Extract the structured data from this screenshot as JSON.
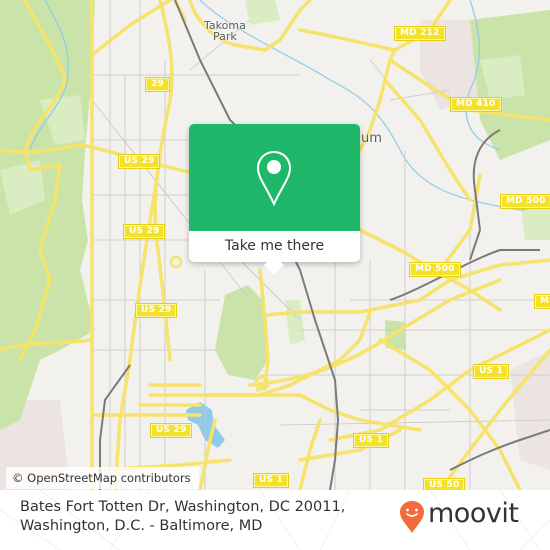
{
  "map": {
    "colors": {
      "land": "#f2f1ed",
      "park": "#c9e3a8",
      "park_light": "#d9ecc2",
      "water": "#8fcbe8",
      "road_major": "#f6e36b",
      "road_minor": "#c9c6c0",
      "rail": "#7a7a7a",
      "urban": "#ebe4e0"
    },
    "place_labels": [
      {
        "id": "takoma-park",
        "lines": [
          "Takoma",
          "Park"
        ]
      },
      {
        "id": "partial-um",
        "lines": [
          "um"
        ]
      }
    ],
    "route_shields": [
      {
        "id": "md-212",
        "label": "MD 212"
      },
      {
        "id": "md-410",
        "label": "MD 410"
      },
      {
        "id": "us-29-a",
        "label": "US 29"
      },
      {
        "id": "us-29-b",
        "label": "US 29"
      },
      {
        "id": "us-29-c",
        "label": "US 29"
      },
      {
        "id": "us-29-d",
        "label": "US 29"
      },
      {
        "id": "md-500-a",
        "label": "MD 500"
      },
      {
        "id": "md-500-b",
        "label": "MD 500"
      },
      {
        "id": "md-partial",
        "label": "MD"
      },
      {
        "id": "us-1-a",
        "label": "US 1"
      },
      {
        "id": "us-1-b",
        "label": "US 1"
      },
      {
        "id": "us-1-c",
        "label": "US 1"
      },
      {
        "id": "us-50",
        "label": "US 50"
      },
      {
        "id": "partial-29",
        "label": "29"
      }
    ],
    "attribution": "© OpenStreetMap contributors"
  },
  "popup": {
    "icon": "map-pin-icon",
    "button_label": "Take me there",
    "color": "#1fb86a"
  },
  "footer": {
    "address_line1": "Bates Fort Totten Dr, Washington, DC 20011,",
    "address_line2": "Washington, D.C. - Baltimore, MD",
    "brand": "moovit",
    "brand_color": "#f26b3a"
  }
}
